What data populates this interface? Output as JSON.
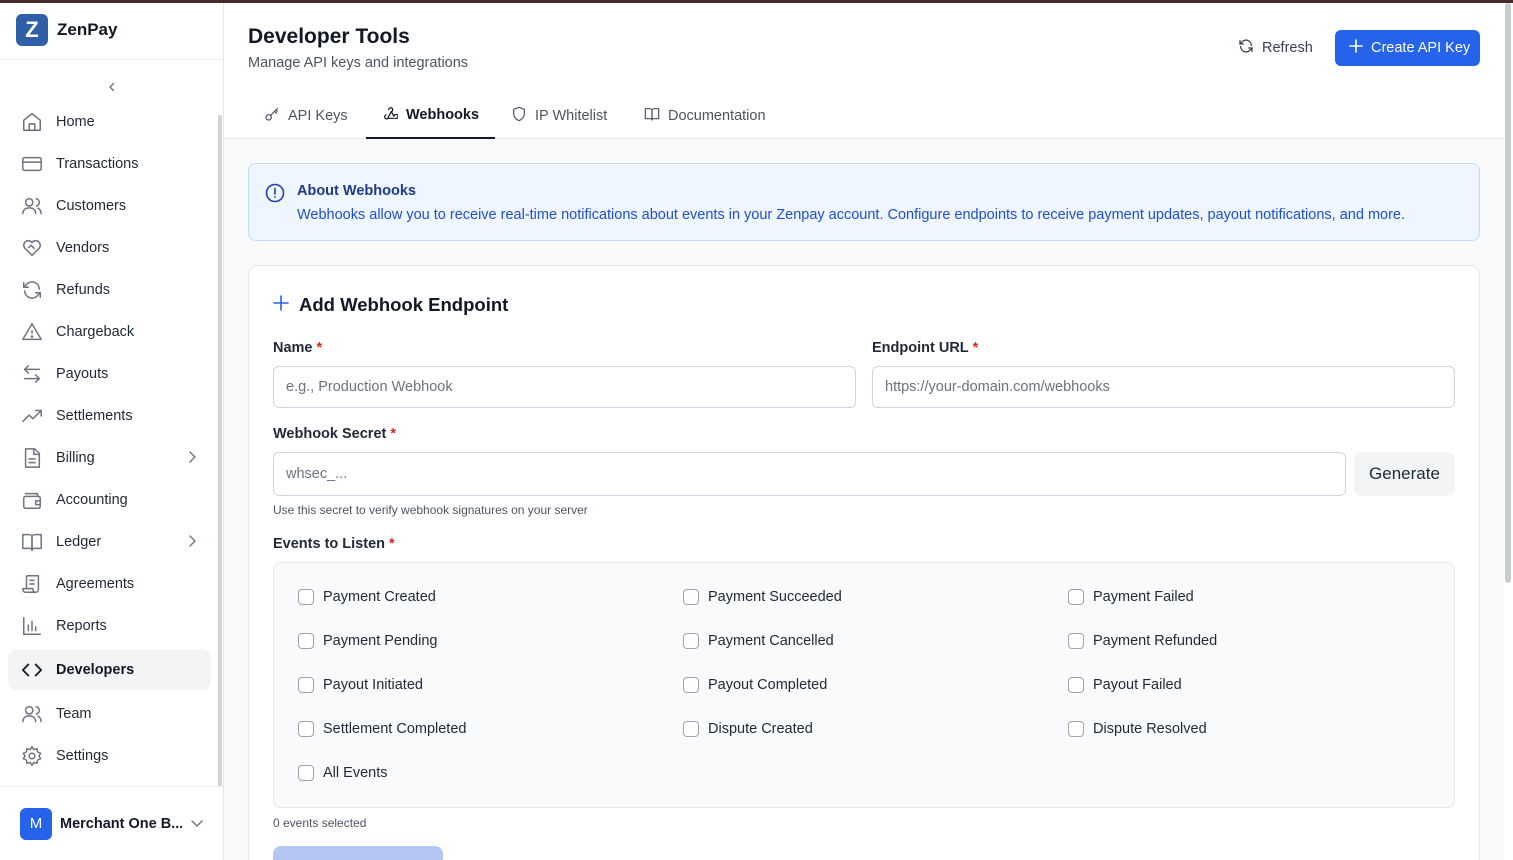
{
  "brand": {
    "logo_letter": "Z",
    "name": "ZenPay"
  },
  "sidebar": {
    "items": [
      {
        "label": "Home",
        "icon": "home-icon"
      },
      {
        "label": "Transactions",
        "icon": "credit-card-icon"
      },
      {
        "label": "Customers",
        "icon": "users-icon"
      },
      {
        "label": "Vendors",
        "icon": "handshake-icon"
      },
      {
        "label": "Refunds",
        "icon": "refresh-icon"
      },
      {
        "label": "Chargeback",
        "icon": "warning-icon"
      },
      {
        "label": "Payouts",
        "icon": "arrows-left-right-icon"
      },
      {
        "label": "Settlements",
        "icon": "trending-up-icon"
      },
      {
        "label": "Billing",
        "icon": "file-text-icon"
      },
      {
        "label": "Accounting",
        "icon": "wallet-icon"
      },
      {
        "label": "Ledger",
        "icon": "book-open-icon"
      },
      {
        "label": "Agreements",
        "icon": "scroll-icon"
      },
      {
        "label": "Reports",
        "icon": "bar-chart-icon"
      },
      {
        "label": "Developers",
        "icon": "code-icon",
        "active": true
      },
      {
        "label": "Team",
        "icon": "users-icon"
      },
      {
        "label": "Settings",
        "icon": "gear-icon"
      }
    ],
    "account": {
      "initial": "M",
      "name": "Merchant One B..."
    }
  },
  "header": {
    "title": "Developer Tools",
    "subtitle": "Manage API keys and integrations",
    "refresh_label": "Refresh",
    "create_label": "Create API Key"
  },
  "tabs": [
    {
      "label": "API Keys",
      "icon": "key-icon"
    },
    {
      "label": "Webhooks",
      "icon": "webhook-icon",
      "active": true
    },
    {
      "label": "IP Whitelist",
      "icon": "shield-icon"
    },
    {
      "label": "Documentation",
      "icon": "book-icon"
    }
  ],
  "info": {
    "title": "About Webhooks",
    "text": "Webhooks allow you to receive real-time notifications about events in your Zenpay account. Configure endpoints to receive payment updates, payout notifications, and more."
  },
  "form": {
    "title": "Add Webhook Endpoint",
    "required_mark": "*",
    "name": {
      "label": "Name",
      "placeholder": "e.g., Production Webhook",
      "value": ""
    },
    "url": {
      "label": "Endpoint URL",
      "placeholder": "https://your-domain.com/webhooks",
      "value": ""
    },
    "secret": {
      "label": "Webhook Secret",
      "placeholder": "whsec_...",
      "value": "",
      "hint": "Use this secret to verify webhook signatures on your server"
    },
    "generate_label": "Generate",
    "events_label": "Events to Listen",
    "events": [
      "Payment Created",
      "Payment Succeeded",
      "Payment Failed",
      "Payment Pending",
      "Payment Cancelled",
      "Payment Refunded",
      "Payout Initiated",
      "Payout Completed",
      "Payout Failed",
      "Settlement Completed",
      "Dispute Created",
      "Dispute Resolved",
      "All Events"
    ],
    "events_selected": "0 events selected"
  },
  "colors": {
    "accent": "#2563eb",
    "info_bg": "#eff6ff",
    "info_text": "#1d4ed8"
  }
}
